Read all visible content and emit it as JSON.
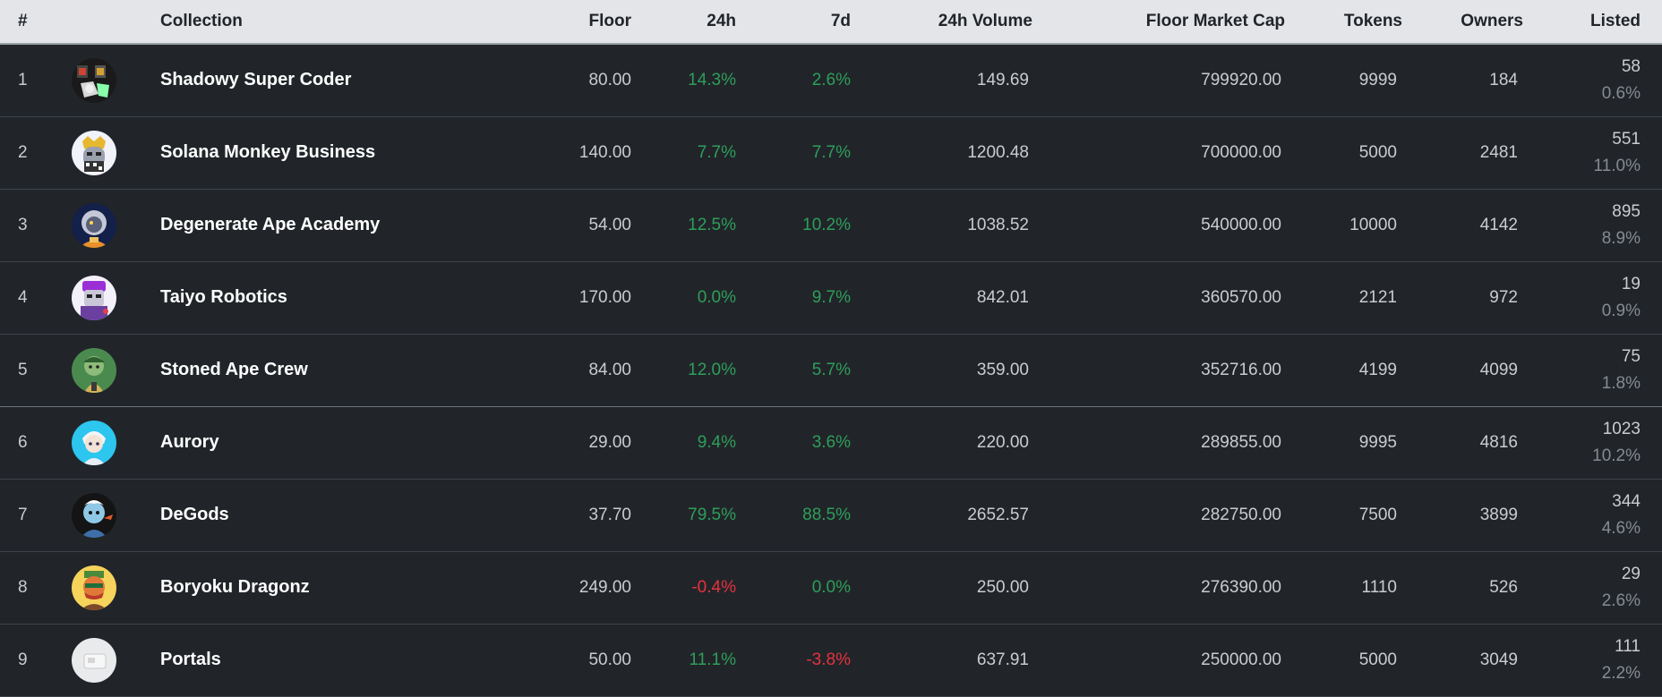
{
  "headers": {
    "rank": "#",
    "collection": "Collection",
    "floor": "Floor",
    "change_24h": "24h",
    "change_7d": "7d",
    "volume_24h": "24h Volume",
    "floor_market_cap": "Floor Market Cap",
    "tokens": "Tokens",
    "owners": "Owners",
    "listed": "Listed"
  },
  "rows": [
    {
      "rank": "1",
      "name": "Shadowy Super Coder",
      "avatar_icon": "shadowy-super-coder-avatar-icon",
      "floor": "80.00",
      "change_24h": "14.3%",
      "change_7d": "2.6%",
      "volume_24h": "149.69",
      "floor_market_cap": "799920.00",
      "tokens": "9999",
      "owners": "184",
      "listed": "58",
      "listed_pct": "0.6%"
    },
    {
      "rank": "2",
      "name": "Solana Monkey Business",
      "avatar_icon": "solana-monkey-business-avatar-icon",
      "floor": "140.00",
      "change_24h": "7.7%",
      "change_7d": "7.7%",
      "volume_24h": "1200.48",
      "floor_market_cap": "700000.00",
      "tokens": "5000",
      "owners": "2481",
      "listed": "551",
      "listed_pct": "11.0%"
    },
    {
      "rank": "3",
      "name": "Degenerate Ape Academy",
      "avatar_icon": "degenerate-ape-academy-avatar-icon",
      "floor": "54.00",
      "change_24h": "12.5%",
      "change_7d": "10.2%",
      "volume_24h": "1038.52",
      "floor_market_cap": "540000.00",
      "tokens": "10000",
      "owners": "4142",
      "listed": "895",
      "listed_pct": "8.9%"
    },
    {
      "rank": "4",
      "name": "Taiyo Robotics",
      "avatar_icon": "taiyo-robotics-avatar-icon",
      "floor": "170.00",
      "change_24h": "0.0%",
      "change_7d": "9.7%",
      "volume_24h": "842.01",
      "floor_market_cap": "360570.00",
      "tokens": "2121",
      "owners": "972",
      "listed": "19",
      "listed_pct": "0.9%"
    },
    {
      "rank": "5",
      "name": "Stoned Ape Crew",
      "avatar_icon": "stoned-ape-crew-avatar-icon",
      "floor": "84.00",
      "change_24h": "12.0%",
      "change_7d": "5.7%",
      "volume_24h": "359.00",
      "floor_market_cap": "352716.00",
      "tokens": "4199",
      "owners": "4099",
      "listed": "75",
      "listed_pct": "1.8%"
    },
    {
      "rank": "6",
      "name": "Aurory",
      "avatar_icon": "aurory-avatar-icon",
      "floor": "29.00",
      "change_24h": "9.4%",
      "change_7d": "3.6%",
      "volume_24h": "220.00",
      "floor_market_cap": "289855.00",
      "tokens": "9995",
      "owners": "4816",
      "listed": "1023",
      "listed_pct": "10.2%"
    },
    {
      "rank": "7",
      "name": "DeGods",
      "avatar_icon": "degods-avatar-icon",
      "floor": "37.70",
      "change_24h": "79.5%",
      "change_7d": "88.5%",
      "volume_24h": "2652.57",
      "floor_market_cap": "282750.00",
      "tokens": "7500",
      "owners": "3899",
      "listed": "344",
      "listed_pct": "4.6%"
    },
    {
      "rank": "8",
      "name": "Boryoku Dragonz",
      "avatar_icon": "boryoku-dragonz-avatar-icon",
      "floor": "249.00",
      "change_24h": "-0.4%",
      "change_7d": "0.0%",
      "volume_24h": "250.00",
      "floor_market_cap": "276390.00",
      "tokens": "1110",
      "owners": "526",
      "listed": "29",
      "listed_pct": "2.6%"
    },
    {
      "rank": "9",
      "name": "Portals",
      "avatar_icon": "portals-avatar-icon",
      "floor": "50.00",
      "change_24h": "11.1%",
      "change_7d": "-3.8%",
      "volume_24h": "637.91",
      "floor_market_cap": "250000.00",
      "tokens": "5000",
      "owners": "3049",
      "listed": "111",
      "listed_pct": "2.2%"
    }
  ],
  "colors": {
    "positive": "#2e9e5b",
    "negative": "#e5323f",
    "background": "#212529",
    "header_background": "#e3e5e8"
  }
}
